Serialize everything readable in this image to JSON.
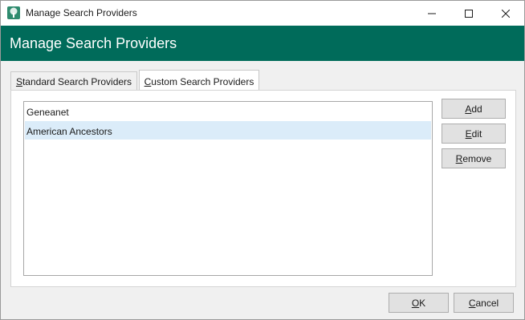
{
  "window": {
    "title": "Manage Search Providers",
    "app_icon": "tree-icon",
    "controls": [
      "minimize-icon",
      "maximize-icon",
      "close-icon"
    ]
  },
  "header": {
    "title": "Manage Search Providers",
    "background_color": "#006b5a"
  },
  "tabs": [
    {
      "label": "Standard Search Providers",
      "underline_char": "S",
      "rest": "tandard Search Providers",
      "active": false
    },
    {
      "label": "Custom Search Providers",
      "underline_char": "C",
      "rest": "ustom Search Providers",
      "active": true
    }
  ],
  "providers": {
    "items": [
      {
        "label": "Geneanet",
        "selected": false
      },
      {
        "label": "American Ancestors",
        "selected": true
      }
    ],
    "selected_color": "#dbecf9"
  },
  "buttons": {
    "add": {
      "underline_char": "A",
      "rest": "dd"
    },
    "edit": {
      "underline_char": "E",
      "rest": "dit"
    },
    "remove": {
      "underline_char": "R",
      "rest": "emove"
    },
    "ok": {
      "underline_char": "O",
      "rest": "K"
    },
    "cancel": {
      "underline_char": "C",
      "rest": "ancel"
    }
  }
}
